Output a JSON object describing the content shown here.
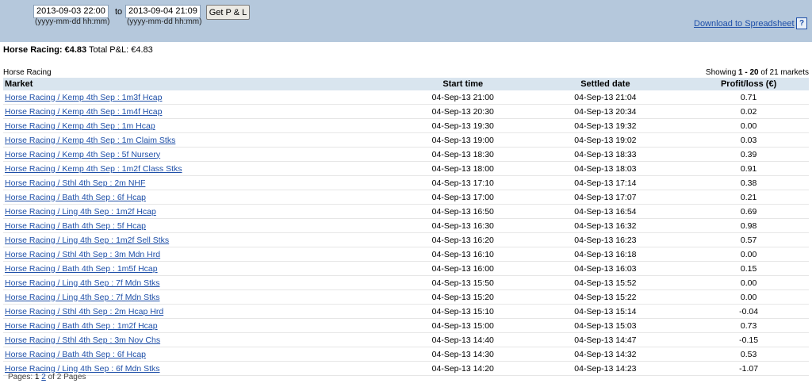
{
  "filter": {
    "from_value": "2013-09-03 22:00",
    "to_label": "to",
    "to_value": "2013-09-04 21:09",
    "from_format": "(yyyy-mm-dd hh:mm)",
    "to_format": "(yyyy-mm-dd hh:mm)",
    "get_button": "Get P & L"
  },
  "download_label": "Download to Spreadsheet",
  "help_icon": "?",
  "summary": {
    "sport_label": "Horse Racing: €4.83",
    "total_label": "Total P&L:",
    "total_value": "€4.83"
  },
  "section_title": "Horse Racing",
  "showing": {
    "prefix": "Showing",
    "range": "1 - 20",
    "suffix": "of 21 markets"
  },
  "table": {
    "headers": [
      "Market",
      "Start time",
      "Settled date",
      "Profit/loss (€)"
    ],
    "rows": [
      {
        "market": "Horse Racing / Kemp 4th Sep : 1m3f Hcap",
        "start": "04-Sep-13 21:00",
        "settled": "04-Sep-13 21:04",
        "pl": "0.71"
      },
      {
        "market": "Horse Racing / Kemp 4th Sep : 1m4f Hcap",
        "start": "04-Sep-13 20:30",
        "settled": "04-Sep-13 20:34",
        "pl": "0.02"
      },
      {
        "market": "Horse Racing / Kemp 4th Sep : 1m Hcap",
        "start": "04-Sep-13 19:30",
        "settled": "04-Sep-13 19:32",
        "pl": "0.00"
      },
      {
        "market": "Horse Racing / Kemp 4th Sep : 1m Claim Stks",
        "start": "04-Sep-13 19:00",
        "settled": "04-Sep-13 19:02",
        "pl": "0.03"
      },
      {
        "market": "Horse Racing / Kemp 4th Sep : 5f Nursery",
        "start": "04-Sep-13 18:30",
        "settled": "04-Sep-13 18:33",
        "pl": "0.39"
      },
      {
        "market": "Horse Racing / Kemp 4th Sep : 1m2f Class Stks",
        "start": "04-Sep-13 18:00",
        "settled": "04-Sep-13 18:03",
        "pl": "0.91"
      },
      {
        "market": "Horse Racing / Sthl 4th Sep : 2m NHF",
        "start": "04-Sep-13 17:10",
        "settled": "04-Sep-13 17:14",
        "pl": "0.38"
      },
      {
        "market": "Horse Racing / Bath 4th Sep : 6f Hcap",
        "start": "04-Sep-13 17:00",
        "settled": "04-Sep-13 17:07",
        "pl": "0.21"
      },
      {
        "market": "Horse Racing / Ling 4th Sep : 1m2f Hcap",
        "start": "04-Sep-13 16:50",
        "settled": "04-Sep-13 16:54",
        "pl": "0.69"
      },
      {
        "market": "Horse Racing / Bath 4th Sep : 5f Hcap",
        "start": "04-Sep-13 16:30",
        "settled": "04-Sep-13 16:32",
        "pl": "0.98"
      },
      {
        "market": "Horse Racing / Ling 4th Sep : 1m2f Sell Stks",
        "start": "04-Sep-13 16:20",
        "settled": "04-Sep-13 16:23",
        "pl": "0.57"
      },
      {
        "market": "Horse Racing / Sthl 4th Sep : 3m Mdn Hrd",
        "start": "04-Sep-13 16:10",
        "settled": "04-Sep-13 16:18",
        "pl": "0.00"
      },
      {
        "market": "Horse Racing / Bath 4th Sep : 1m5f Hcap",
        "start": "04-Sep-13 16:00",
        "settled": "04-Sep-13 16:03",
        "pl": "0.15"
      },
      {
        "market": "Horse Racing / Ling 4th Sep : 7f Mdn Stks",
        "start": "04-Sep-13 15:50",
        "settled": "04-Sep-13 15:52",
        "pl": "0.00"
      },
      {
        "market": "Horse Racing / Ling 4th Sep : 7f Mdn Stks",
        "start": "04-Sep-13 15:20",
        "settled": "04-Sep-13 15:22",
        "pl": "0.00"
      },
      {
        "market": "Horse Racing / Sthl 4th Sep : 2m Hcap Hrd",
        "start": "04-Sep-13 15:10",
        "settled": "04-Sep-13 15:14",
        "pl": "-0.04"
      },
      {
        "market": "Horse Racing / Bath 4th Sep : 1m2f Hcap",
        "start": "04-Sep-13 15:00",
        "settled": "04-Sep-13 15:03",
        "pl": "0.73"
      },
      {
        "market": "Horse Racing / Sthl 4th Sep : 3m Nov Chs",
        "start": "04-Sep-13 14:40",
        "settled": "04-Sep-13 14:47",
        "pl": "-0.15"
      },
      {
        "market": "Horse Racing / Bath 4th Sep : 6f Hcap",
        "start": "04-Sep-13 14:30",
        "settled": "04-Sep-13 14:32",
        "pl": "0.53"
      },
      {
        "market": "Horse Racing / Ling 4th Sep : 6f Mdn Stks",
        "start": "04-Sep-13 14:20",
        "settled": "04-Sep-13 14:23",
        "pl": "-1.07"
      }
    ]
  },
  "pagination": {
    "prefix": "Pages:",
    "current": "1",
    "next": "2",
    "suffix": "of 2 Pages"
  },
  "colors": {
    "header_bar": "#b5c8dc",
    "table_header": "#d9e5ef",
    "link": "#1e4fa8"
  }
}
